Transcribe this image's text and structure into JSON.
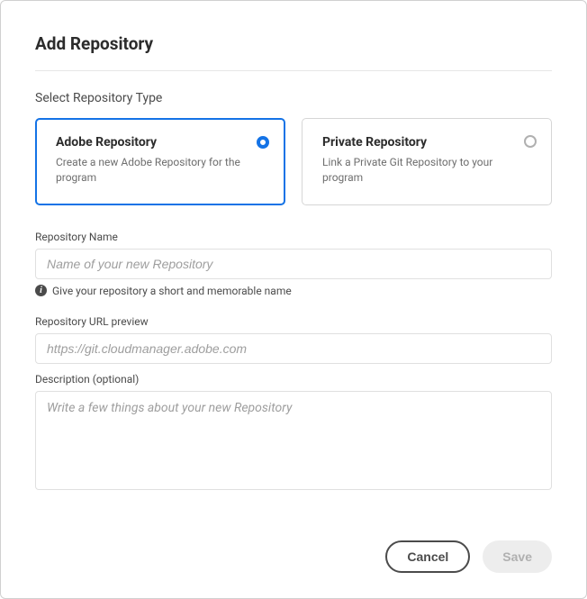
{
  "modal": {
    "title": "Add Repository"
  },
  "typeSection": {
    "label": "Select Repository Type",
    "options": [
      {
        "title": "Adobe Repository",
        "desc": "Create a new Adobe Repository for the program",
        "selected": true
      },
      {
        "title": "Private Repository",
        "desc": "Link a Private Git Repository to your program",
        "selected": false
      }
    ]
  },
  "fields": {
    "name": {
      "label": "Repository Name",
      "placeholder": "Name of your new Repository",
      "value": "",
      "hint": "Give your repository a short and memorable name"
    },
    "urlPreview": {
      "label": "Repository URL preview",
      "value": "https://git.cloudmanager.adobe.com"
    },
    "description": {
      "label": "Description (optional)",
      "placeholder": "Write a few things about your new Repository",
      "value": ""
    }
  },
  "footer": {
    "cancel": "Cancel",
    "save": "Save"
  }
}
